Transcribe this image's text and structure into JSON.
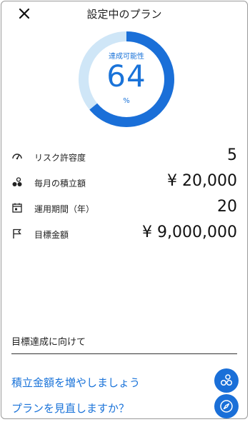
{
  "header": {
    "title": "設定中のプラン"
  },
  "gauge": {
    "label": "達成可能性",
    "value": "64",
    "unit": "%",
    "percent": 64
  },
  "rows": [
    {
      "name": "risk-tolerance",
      "icon": "gauge-icon",
      "label": "リスク許容度",
      "value": "5"
    },
    {
      "name": "monthly-deposit",
      "icon": "coins-icon",
      "label": "毎月の積立額",
      "value": "¥ 20,000"
    },
    {
      "name": "investment-period",
      "icon": "calendar-icon",
      "label": "運用期間（年）",
      "value": "20"
    },
    {
      "name": "target-amount",
      "icon": "flag-icon",
      "label": "目標金額",
      "value": "¥ 9,000,000"
    }
  ],
  "section": {
    "title": "目標達成に向けて"
  },
  "actions": [
    {
      "name": "increase-deposit",
      "label": "積立金額を増やしましょう",
      "icon": "coins-icon"
    },
    {
      "name": "review-plan",
      "label": "プランを見直しますか？",
      "icon": "compass-icon"
    }
  ],
  "colors": {
    "accent": "#1a73d9",
    "gauge_track": "#cfe6f7",
    "gauge_fill": "#1a6fd8"
  }
}
